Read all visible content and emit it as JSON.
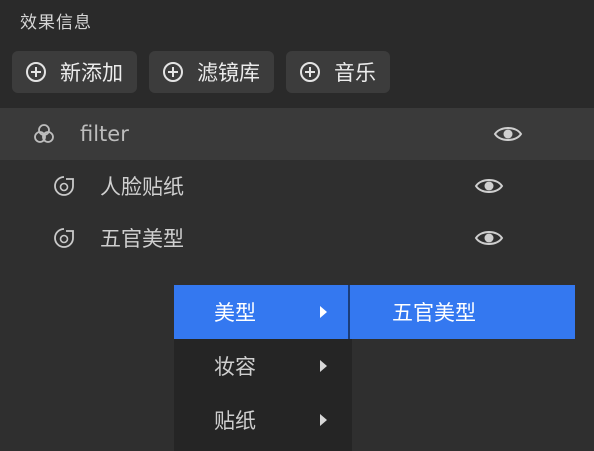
{
  "panel": {
    "title": "效果信息"
  },
  "toolbar": {
    "buttons": [
      {
        "label": "新添加",
        "icon": "plus-circle-icon"
      },
      {
        "label": "滤镜库",
        "icon": "plus-circle-icon"
      },
      {
        "label": "音乐",
        "icon": "plus-circle-icon"
      }
    ]
  },
  "tree": {
    "group": {
      "label": "filter",
      "icon": "filter-group-icon",
      "visible": true
    },
    "children": [
      {
        "label": "人脸贴纸",
        "icon": "effect-item-icon",
        "visible": true
      },
      {
        "label": "五官美型",
        "icon": "effect-item-icon",
        "visible": true
      }
    ]
  },
  "context_menu": {
    "items": [
      {
        "label": "美型",
        "active": true
      },
      {
        "label": "妆容",
        "active": false
      },
      {
        "label": "贴纸",
        "active": false
      }
    ],
    "submenu": {
      "items": [
        {
          "label": "五官美型"
        }
      ]
    }
  },
  "colors": {
    "background": "#2f2f2f",
    "header": "#2a2a2a",
    "button": "#3c3c3c",
    "selected_row": "#3a3a3a",
    "menu": "#252525",
    "accent": "#3478f0"
  }
}
